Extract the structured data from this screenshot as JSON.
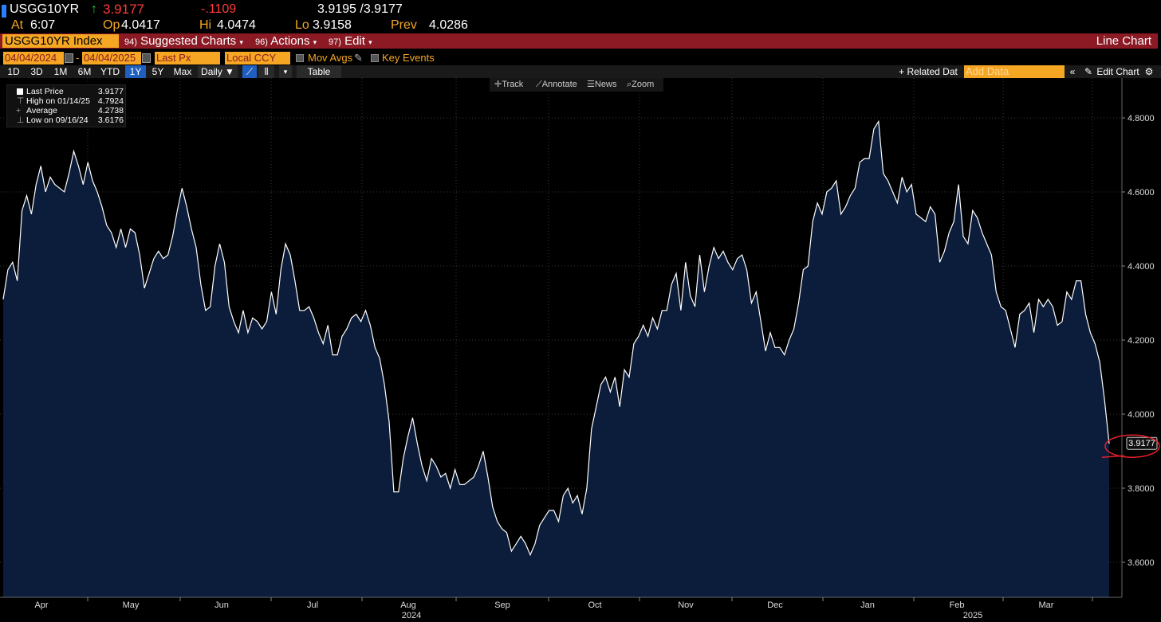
{
  "quote": {
    "ticker": "USGG10YR",
    "arrow": "↑",
    "last": "3.9177",
    "change": "-.1109",
    "bid_ask": "3.9195 /3.9177",
    "at_label": "At",
    "at_time": "6:07",
    "op_label": "Op",
    "op": "4.0417",
    "hi_label": "Hi",
    "hi": "4.0474",
    "lo_label": "Lo",
    "lo": "3.9158",
    "prev_label": "Prev",
    "prev": "4.0286"
  },
  "menubar": {
    "security": "USGG10YR Index",
    "suggested_num": "94)",
    "suggested": "Suggested Charts",
    "actions_num": "96)",
    "actions": "Actions",
    "edit_num": "97)",
    "edit": "Edit",
    "chart_type": "Line Chart"
  },
  "daterow": {
    "start": "04/04/2024",
    "dash": "-",
    "end": "04/04/2025",
    "field": "Last Px",
    "currency": "Local CCY",
    "mov_avgs": "Mov Avgs",
    "key_events": "Key Events"
  },
  "rangebar": {
    "ranges": [
      "1D",
      "3D",
      "1M",
      "6M",
      "YTD",
      "1Y",
      "5Y",
      "Max"
    ],
    "selected": "1Y",
    "period": "Daily ▼",
    "table": "Table",
    "related": "+ Related Dat",
    "add_data_placeholder": "Add Data",
    "edit_chart": "Edit Chart"
  },
  "toolbar": {
    "track": "Track",
    "annotate": "Annotate",
    "news": "News",
    "zoom": "Zoom"
  },
  "legend": {
    "last_label": "Last Price",
    "last_value": "3.9177",
    "high_label": "High on 01/14/25",
    "high_value": "4.7924",
    "avg_label": "Average",
    "avg_value": "4.2738",
    "low_label": "Low on 09/16/24",
    "low_value": "3.6176"
  },
  "colors": {
    "area_fill": "#0b1d3a",
    "line": "#ffffff",
    "accent_orange": "#f5a623",
    "menu_red": "#8b1a24",
    "annotation_red": "#e8202a"
  },
  "chart_data": {
    "type": "area",
    "x_tick_labels": [
      "Apr",
      "May",
      "Jun",
      "Jul",
      "Aug",
      "Sep",
      "Oct",
      "Nov",
      "Dec",
      "Jan",
      "Feb",
      "Mar"
    ],
    "year_labels": [
      "2024",
      "2025"
    ],
    "y_ticks": [
      "4.8000",
      "4.6000",
      "4.4000",
      "4.2000",
      "4.0000",
      "3.8000",
      "3.6000"
    ],
    "ylim": [
      3.5,
      4.8
    ],
    "last_value_label": "3.9177",
    "grid": true,
    "series": [
      {
        "values": [
          4.31,
          4.39,
          4.41,
          4.36,
          4.55,
          4.59,
          4.54,
          4.62,
          4.67,
          4.6,
          4.64,
          4.62,
          4.61,
          4.6,
          4.65,
          4.71,
          4.67,
          4.62,
          4.68,
          4.63,
          4.6,
          4.56,
          4.51,
          4.49,
          4.45,
          4.5,
          4.45,
          4.5,
          4.49,
          4.43,
          4.34,
          4.38,
          4.42,
          4.44,
          4.42,
          4.43,
          4.48,
          4.55,
          4.61,
          4.56,
          4.5,
          4.45,
          4.35,
          4.28,
          4.29,
          4.4,
          4.46,
          4.41,
          4.29,
          4.25,
          4.22,
          4.28,
          4.22,
          4.26,
          4.25,
          4.23,
          4.25,
          4.33,
          4.27,
          4.39,
          4.46,
          4.43,
          4.36,
          4.28,
          4.28,
          4.29,
          4.26,
          4.22,
          4.19,
          4.24,
          4.16,
          4.16,
          4.21,
          4.23,
          4.26,
          4.27,
          4.25,
          4.28,
          4.24,
          4.18,
          4.15,
          4.08,
          3.98,
          3.79,
          3.79,
          3.88,
          3.94,
          3.99,
          3.92,
          3.86,
          3.82,
          3.88,
          3.86,
          3.83,
          3.84,
          3.8,
          3.85,
          3.81,
          3.81,
          3.82,
          3.83,
          3.86,
          3.9,
          3.83,
          3.75,
          3.71,
          3.69,
          3.68,
          3.63,
          3.65,
          3.67,
          3.65,
          3.62,
          3.65,
          3.7,
          3.72,
          3.74,
          3.74,
          3.71,
          3.78,
          3.8,
          3.76,
          3.78,
          3.73,
          3.8,
          3.96,
          4.02,
          4.08,
          4.1,
          4.06,
          4.1,
          4.02,
          4.12,
          4.1,
          4.19,
          4.21,
          4.24,
          4.21,
          4.26,
          4.23,
          4.28,
          4.28,
          4.35,
          4.38,
          4.28,
          4.41,
          4.32,
          4.29,
          4.43,
          4.33,
          4.4,
          4.45,
          4.42,
          4.44,
          4.41,
          4.39,
          4.42,
          4.43,
          4.39,
          4.3,
          4.33,
          4.25,
          4.17,
          4.22,
          4.18,
          4.18,
          4.16,
          4.2,
          4.23,
          4.3,
          4.39,
          4.4,
          4.52,
          4.57,
          4.54,
          4.6,
          4.61,
          4.63,
          4.54,
          4.56,
          4.59,
          4.61,
          4.68,
          4.69,
          4.69,
          4.77,
          4.79,
          4.65,
          4.63,
          4.6,
          4.57,
          4.64,
          4.6,
          4.62,
          4.54,
          4.53,
          4.52,
          4.56,
          4.54,
          4.41,
          4.44,
          4.49,
          4.52,
          4.62,
          4.48,
          4.46,
          4.55,
          4.53,
          4.49,
          4.46,
          4.43,
          4.33,
          4.29,
          4.28,
          4.23,
          4.18,
          4.27,
          4.28,
          4.3,
          4.22,
          4.31,
          4.29,
          4.31,
          4.29,
          4.24,
          4.25,
          4.33,
          4.31,
          4.36,
          4.36,
          4.27,
          4.22,
          4.19,
          4.14,
          4.04,
          3.92
        ]
      }
    ]
  }
}
